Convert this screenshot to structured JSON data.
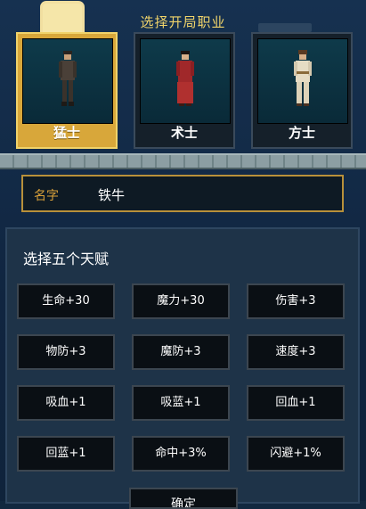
{
  "header": {
    "title": "选择开局职业"
  },
  "classes": [
    {
      "label": "猛士",
      "selected": true
    },
    {
      "label": "术士",
      "selected": false
    },
    {
      "label": "方士",
      "selected": false
    }
  ],
  "name": {
    "label": "名字",
    "value": "铁牛"
  },
  "talents": {
    "title": "选择五个天赋",
    "items": [
      "生命+30",
      "魔力+30",
      "伤害+3",
      "物防+3",
      "魔防+3",
      "速度+3",
      "吸血+1",
      "吸蓝+1",
      "回血+1",
      "回蓝+1",
      "命中+3%",
      "闪避+1%"
    ]
  },
  "confirm": {
    "label": "确定"
  },
  "colors": {
    "accent": "#d8a73a",
    "title": "#f0d36a",
    "name_label": "#d9a13a"
  }
}
